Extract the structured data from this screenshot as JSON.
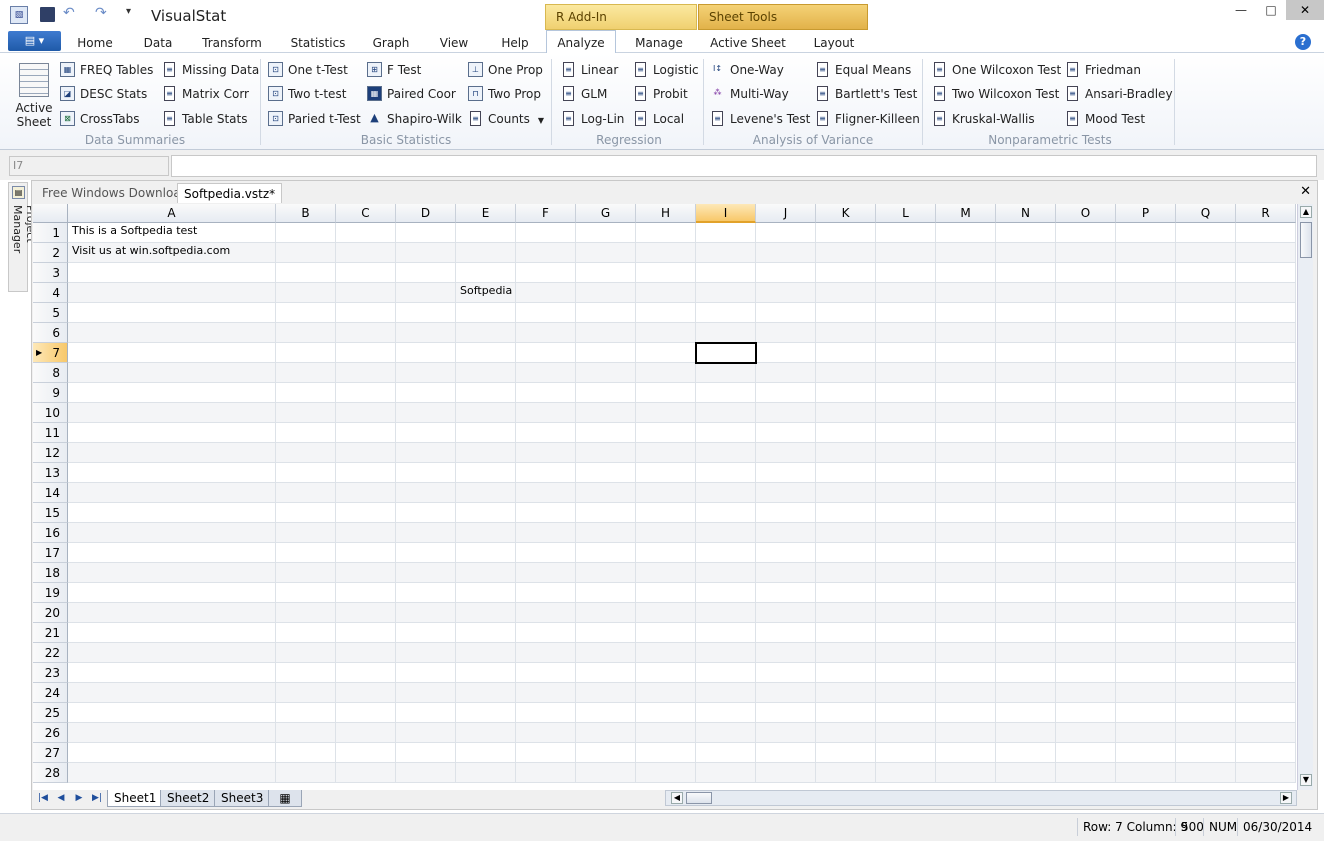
{
  "title": "VisualStat",
  "window_controls": {
    "minimize": "—",
    "maximize": "□",
    "close": "✕"
  },
  "context_tabs": {
    "r_addin": "R Add-In",
    "sheet_tools": "Sheet Tools"
  },
  "ribbon_tabs": [
    "Home",
    "Data",
    "Transform",
    "Statistics",
    "Graph",
    "View",
    "Help",
    "Analyze",
    "Manage",
    "Active Sheet",
    "Layout"
  ],
  "active_tab": "Analyze",
  "help": "?",
  "ribbon": {
    "active_sheet": {
      "line1": "Active",
      "line2": "Sheet"
    },
    "groups": {
      "data_summaries": {
        "label": "Data Summaries",
        "items": [
          "FREQ Tables",
          "DESC Stats",
          "CrossTabs",
          "Missing Data",
          "Matrix Corr",
          "Table Stats"
        ]
      },
      "basic_statistics": {
        "label": "Basic Statistics",
        "items": [
          "One t-Test",
          "Two t-test",
          "Paried t-Test",
          "F Test",
          "Paired Coor",
          "Shapiro-Wilk",
          "One Prop",
          "Two Prop",
          "Counts"
        ]
      },
      "regression": {
        "label": "Regression",
        "items": [
          "Linear",
          "GLM",
          "Log-Lin",
          "Logistic",
          "Probit",
          "Local"
        ]
      },
      "anova": {
        "label": "Analysis of Variance",
        "items": [
          "One-Way",
          "Multi-Way",
          "Levene's Test",
          "Equal Means",
          "Bartlett's Test",
          "Fligner-Killeen"
        ]
      },
      "nonparametric": {
        "label": "Nonparametric Tests",
        "items": [
          "One Wilcoxon Test",
          "Two Wilcoxon Test",
          "Kruskal-Wallis",
          "Friedman",
          "Ansari-Bradley",
          "Mood Test"
        ]
      }
    }
  },
  "formula_bar": {
    "name_box": "I7",
    "formula": ""
  },
  "side_panel": {
    "label": "Project Manager"
  },
  "doc_tabs": [
    "Free Windows Downloads",
    "Softpedia.vstz*"
  ],
  "doc_close": "✕",
  "grid": {
    "columns": [
      "A",
      "B",
      "C",
      "D",
      "E",
      "F",
      "G",
      "H",
      "I",
      "J",
      "K",
      "L",
      "M",
      "N",
      "O",
      "P",
      "Q",
      "R"
    ],
    "rows": [
      "1",
      "2",
      "3",
      "4",
      "5",
      "6",
      "7",
      "8",
      "9",
      "10",
      "11",
      "12",
      "13",
      "14",
      "15",
      "16",
      "17",
      "18",
      "19",
      "20",
      "21",
      "22",
      "23",
      "24",
      "25",
      "26",
      "27",
      "28"
    ],
    "selected_column": "I",
    "selected_row": "7",
    "cells": {
      "A1": "This is a Softpedia test",
      "A2": "Visit us at win.softpedia.com",
      "E4": "Softpedia"
    }
  },
  "sheet_tabs": [
    "Sheet1",
    "Sheet2",
    "Sheet3"
  ],
  "active_sheet_tab": "Sheet1",
  "status": {
    "position": "Row: 7 Column: 9",
    "count": "500",
    "mode": "NUM",
    "date": "06/30/2014"
  }
}
